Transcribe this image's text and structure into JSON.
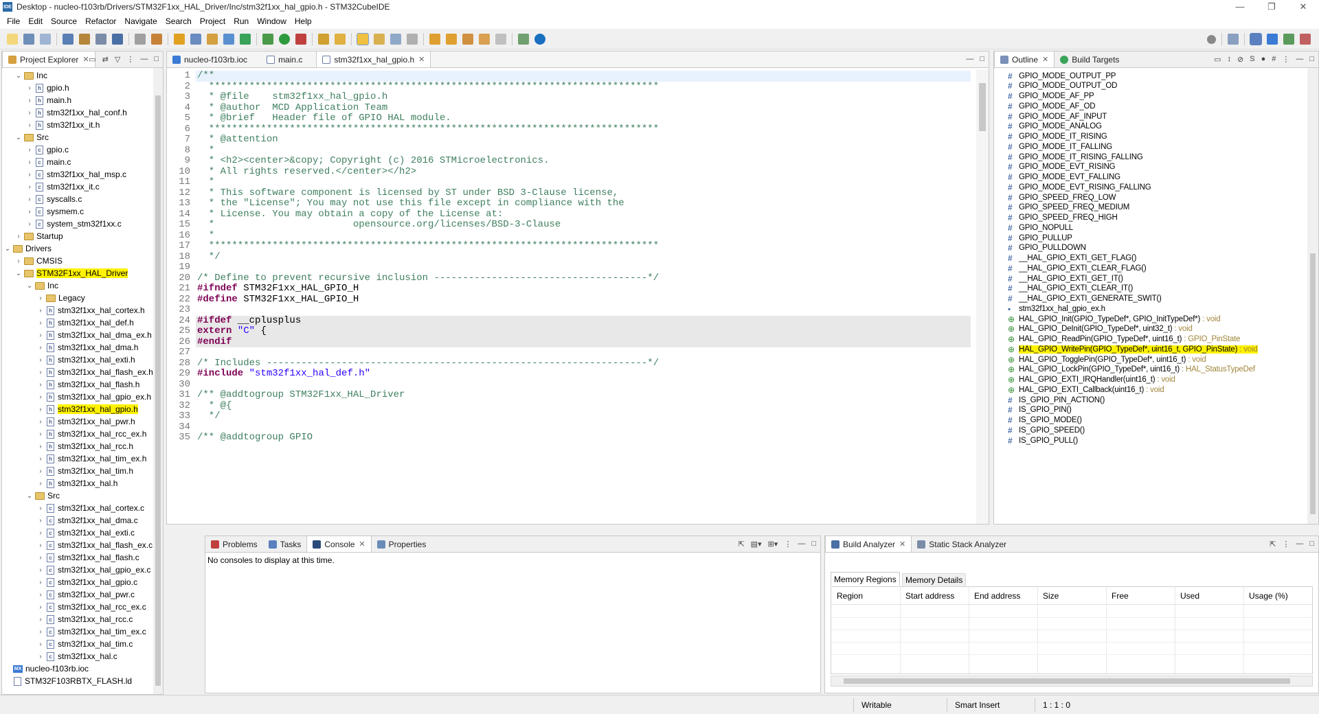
{
  "window": {
    "title": "Desktop - nucleo-f103rb/Drivers/STM32F1xx_HAL_Driver/Inc/stm32f1xx_hal_gpio.h - STM32CubeIDE",
    "app_icon": "IDE",
    "controls": [
      "—",
      "❐",
      "✕"
    ]
  },
  "menu": [
    "File",
    "Edit",
    "Source",
    "Refactor",
    "Navigate",
    "Search",
    "Project",
    "Run",
    "Window",
    "Help"
  ],
  "project_explorer": {
    "title": "Project Explorer",
    "items": [
      {
        "label": "Inc",
        "type": "folder",
        "level": 2,
        "arrow": "open"
      },
      {
        "label": "gpio.h",
        "type": "h",
        "level": 3,
        "arrow": "closed"
      },
      {
        "label": "main.h",
        "type": "h",
        "level": 3,
        "arrow": "closed"
      },
      {
        "label": "stm32f1xx_hal_conf.h",
        "type": "h",
        "level": 3,
        "arrow": "closed"
      },
      {
        "label": "stm32f1xx_it.h",
        "type": "h",
        "level": 3,
        "arrow": "closed"
      },
      {
        "label": "Src",
        "type": "folder",
        "level": 2,
        "arrow": "open"
      },
      {
        "label": "gpio.c",
        "type": "c",
        "level": 3,
        "arrow": "closed"
      },
      {
        "label": "main.c",
        "type": "c",
        "level": 3,
        "arrow": "closed"
      },
      {
        "label": "stm32f1xx_hal_msp.c",
        "type": "c",
        "level": 3,
        "arrow": "closed"
      },
      {
        "label": "stm32f1xx_it.c",
        "type": "c",
        "level": 3,
        "arrow": "closed"
      },
      {
        "label": "syscalls.c",
        "type": "c",
        "level": 3,
        "arrow": "closed"
      },
      {
        "label": "sysmem.c",
        "type": "c",
        "level": 3,
        "arrow": "closed"
      },
      {
        "label": "system_stm32f1xx.c",
        "type": "c",
        "level": 3,
        "arrow": "closed"
      },
      {
        "label": "Startup",
        "type": "folder",
        "level": 2,
        "arrow": "closed"
      },
      {
        "label": "Drivers",
        "type": "folder",
        "level": 1,
        "arrow": "open"
      },
      {
        "label": "CMSIS",
        "type": "folder",
        "level": 2,
        "arrow": "closed"
      },
      {
        "label": "STM32F1xx_HAL_Driver",
        "type": "folder",
        "level": 2,
        "arrow": "open",
        "highlight": true
      },
      {
        "label": "Inc",
        "type": "folder",
        "level": 3,
        "arrow": "open"
      },
      {
        "label": "Legacy",
        "type": "folder",
        "level": 4,
        "arrow": "closed"
      },
      {
        "label": "stm32f1xx_hal_cortex.h",
        "type": "h",
        "level": 4,
        "arrow": "closed"
      },
      {
        "label": "stm32f1xx_hal_def.h",
        "type": "h",
        "level": 4,
        "arrow": "closed"
      },
      {
        "label": "stm32f1xx_hal_dma_ex.h",
        "type": "h",
        "level": 4,
        "arrow": "closed"
      },
      {
        "label": "stm32f1xx_hal_dma.h",
        "type": "h",
        "level": 4,
        "arrow": "closed"
      },
      {
        "label": "stm32f1xx_hal_exti.h",
        "type": "h",
        "level": 4,
        "arrow": "closed"
      },
      {
        "label": "stm32f1xx_hal_flash_ex.h",
        "type": "h",
        "level": 4,
        "arrow": "closed"
      },
      {
        "label": "stm32f1xx_hal_flash.h",
        "type": "h",
        "level": 4,
        "arrow": "closed"
      },
      {
        "label": "stm32f1xx_hal_gpio_ex.h",
        "type": "h",
        "level": 4,
        "arrow": "closed"
      },
      {
        "label": "stm32f1xx_hal_gpio.h",
        "type": "h",
        "level": 4,
        "arrow": "closed",
        "highlight": true
      },
      {
        "label": "stm32f1xx_hal_pwr.h",
        "type": "h",
        "level": 4,
        "arrow": "closed"
      },
      {
        "label": "stm32f1xx_hal_rcc_ex.h",
        "type": "h",
        "level": 4,
        "arrow": "closed"
      },
      {
        "label": "stm32f1xx_hal_rcc.h",
        "type": "h",
        "level": 4,
        "arrow": "closed"
      },
      {
        "label": "stm32f1xx_hal_tim_ex.h",
        "type": "h",
        "level": 4,
        "arrow": "closed"
      },
      {
        "label": "stm32f1xx_hal_tim.h",
        "type": "h",
        "level": 4,
        "arrow": "closed"
      },
      {
        "label": "stm32f1xx_hal.h",
        "type": "h",
        "level": 4,
        "arrow": "closed"
      },
      {
        "label": "Src",
        "type": "folder",
        "level": 3,
        "arrow": "open"
      },
      {
        "label": "stm32f1xx_hal_cortex.c",
        "type": "c",
        "level": 4,
        "arrow": "closed"
      },
      {
        "label": "stm32f1xx_hal_dma.c",
        "type": "c",
        "level": 4,
        "arrow": "closed"
      },
      {
        "label": "stm32f1xx_hal_exti.c",
        "type": "c",
        "level": 4,
        "arrow": "closed"
      },
      {
        "label": "stm32f1xx_hal_flash_ex.c",
        "type": "c",
        "level": 4,
        "arrow": "closed"
      },
      {
        "label": "stm32f1xx_hal_flash.c",
        "type": "c",
        "level": 4,
        "arrow": "closed"
      },
      {
        "label": "stm32f1xx_hal_gpio_ex.c",
        "type": "c",
        "level": 4,
        "arrow": "closed"
      },
      {
        "label": "stm32f1xx_hal_gpio.c",
        "type": "c",
        "level": 4,
        "arrow": "closed"
      },
      {
        "label": "stm32f1xx_hal_pwr.c",
        "type": "c",
        "level": 4,
        "arrow": "closed"
      },
      {
        "label": "stm32f1xx_hal_rcc_ex.c",
        "type": "c",
        "level": 4,
        "arrow": "closed"
      },
      {
        "label": "stm32f1xx_hal_rcc.c",
        "type": "c",
        "level": 4,
        "arrow": "closed"
      },
      {
        "label": "stm32f1xx_hal_tim_ex.c",
        "type": "c",
        "level": 4,
        "arrow": "closed"
      },
      {
        "label": "stm32f1xx_hal_tim.c",
        "type": "c",
        "level": 4,
        "arrow": "closed"
      },
      {
        "label": "stm32f1xx_hal.c",
        "type": "c",
        "level": 4,
        "arrow": "closed"
      },
      {
        "label": "nucleo-f103rb.ioc",
        "type": "mx",
        "level": 1,
        "arrow": "none"
      },
      {
        "label": "STM32F103RBTX_FLASH.ld",
        "type": "ld",
        "level": 1,
        "arrow": "none"
      }
    ]
  },
  "editor": {
    "tabs": [
      {
        "label": "nucleo-f103rb.ioc",
        "active": false
      },
      {
        "label": "main.c",
        "active": false
      },
      {
        "label": "stm32f1xx_hal_gpio.h",
        "active": true
      }
    ],
    "lines": [
      {
        "n": "1",
        "segs": [
          [
            "cm",
            "/**"
          ]
        ]
      },
      {
        "n": "2",
        "segs": [
          [
            "cm",
            "  ******************************************************************************"
          ]
        ]
      },
      {
        "n": "3",
        "segs": [
          [
            "cm",
            "  * @file    stm32f1xx_hal_gpio.h"
          ]
        ]
      },
      {
        "n": "4",
        "segs": [
          [
            "cm",
            "  * @author  MCD Application Team"
          ]
        ]
      },
      {
        "n": "5",
        "segs": [
          [
            "cm",
            "  * @brief   Header file of GPIO HAL module."
          ]
        ]
      },
      {
        "n": "6",
        "segs": [
          [
            "cm",
            "  ******************************************************************************"
          ]
        ]
      },
      {
        "n": "7",
        "segs": [
          [
            "cm",
            "  * @attention"
          ]
        ]
      },
      {
        "n": "8",
        "segs": [
          [
            "cm",
            "  *"
          ]
        ]
      },
      {
        "n": "9",
        "segs": [
          [
            "cm",
            "  * <h2><center>&copy; Copyright (c) 2016 STMicroelectronics."
          ]
        ]
      },
      {
        "n": "10",
        "segs": [
          [
            "cm",
            "  * All rights reserved.</center></h2>"
          ]
        ]
      },
      {
        "n": "11",
        "segs": [
          [
            "cm",
            "  *"
          ]
        ]
      },
      {
        "n": "12",
        "segs": [
          [
            "cm",
            "  * This software component is licensed by ST under BSD 3-Clause license,"
          ]
        ]
      },
      {
        "n": "13",
        "segs": [
          [
            "cm",
            "  * the \"License\"; You may not use this file except in compliance with the"
          ]
        ]
      },
      {
        "n": "14",
        "segs": [
          [
            "cm",
            "  * License. You may obtain a copy of the License at:"
          ]
        ]
      },
      {
        "n": "15",
        "segs": [
          [
            "cm",
            "  *                        opensource.org/licenses/BSD-3-Clause"
          ]
        ]
      },
      {
        "n": "16",
        "segs": [
          [
            "cm",
            "  *"
          ]
        ]
      },
      {
        "n": "17",
        "segs": [
          [
            "cm",
            "  ******************************************************************************"
          ]
        ]
      },
      {
        "n": "18",
        "segs": [
          [
            "cm",
            "  */"
          ]
        ]
      },
      {
        "n": "19",
        "segs": [
          [
            "",
            ""
          ]
        ]
      },
      {
        "n": "20",
        "segs": [
          [
            "cm",
            "/* Define to prevent recursive inclusion -------------------------------------*/"
          ]
        ]
      },
      {
        "n": "21",
        "segs": [
          [
            "kw",
            "#ifndef"
          ],
          [
            "",
            " STM32F1xx_HAL_GPIO_H"
          ]
        ]
      },
      {
        "n": "22",
        "segs": [
          [
            "kw",
            "#define"
          ],
          [
            "",
            " STM32F1xx_HAL_GPIO_H"
          ]
        ]
      },
      {
        "n": "23",
        "segs": [
          [
            "",
            ""
          ]
        ]
      },
      {
        "n": "24",
        "segs": [
          [
            "kw",
            "#ifdef"
          ],
          [
            "",
            " __cplusplus"
          ]
        ],
        "grey": true
      },
      {
        "n": "25",
        "segs": [
          [
            "kw",
            "extern"
          ],
          [
            "",
            " "
          ],
          [
            "st",
            "\"C\""
          ],
          [
            "",
            " {"
          ]
        ],
        "grey": true
      },
      {
        "n": "26",
        "segs": [
          [
            "kw",
            "#endif"
          ]
        ],
        "grey": true
      },
      {
        "n": "27",
        "segs": [
          [
            "",
            ""
          ]
        ]
      },
      {
        "n": "28",
        "segs": [
          [
            "cm",
            "/* Includes ------------------------------------------------------------------*/"
          ]
        ]
      },
      {
        "n": "29",
        "segs": [
          [
            "kw",
            "#include"
          ],
          [
            "",
            " "
          ],
          [
            "st",
            "\"stm32f1xx_hal_def.h\""
          ]
        ]
      },
      {
        "n": "30",
        "segs": [
          [
            "",
            ""
          ]
        ]
      },
      {
        "n": "31",
        "segs": [
          [
            "cm",
            "/** @addtogroup STM32F1xx_HAL_Driver"
          ]
        ]
      },
      {
        "n": "32",
        "segs": [
          [
            "cm",
            "  * @{"
          ]
        ]
      },
      {
        "n": "33",
        "segs": [
          [
            "cm",
            "  */"
          ]
        ]
      },
      {
        "n": "34",
        "segs": [
          [
            "",
            ""
          ]
        ]
      },
      {
        "n": "35",
        "segs": [
          [
            "cm",
            "/** @addtogroup GPIO"
          ]
        ]
      }
    ]
  },
  "outline": {
    "tabs": [
      "Outline",
      "Build Targets"
    ],
    "items": [
      {
        "kind": "define",
        "label": "GPIO_MODE_OUTPUT_PP"
      },
      {
        "kind": "define",
        "label": "GPIO_MODE_OUTPUT_OD"
      },
      {
        "kind": "define",
        "label": "GPIO_MODE_AF_PP"
      },
      {
        "kind": "define",
        "label": "GPIO_MODE_AF_OD"
      },
      {
        "kind": "define",
        "label": "GPIO_MODE_AF_INPUT"
      },
      {
        "kind": "define",
        "label": "GPIO_MODE_ANALOG"
      },
      {
        "kind": "define",
        "label": "GPIO_MODE_IT_RISING"
      },
      {
        "kind": "define",
        "label": "GPIO_MODE_IT_FALLING"
      },
      {
        "kind": "define",
        "label": "GPIO_MODE_IT_RISING_FALLING"
      },
      {
        "kind": "define",
        "label": "GPIO_MODE_EVT_RISING"
      },
      {
        "kind": "define",
        "label": "GPIO_MODE_EVT_FALLING"
      },
      {
        "kind": "define",
        "label": "GPIO_MODE_EVT_RISING_FALLING"
      },
      {
        "kind": "define",
        "label": "GPIO_SPEED_FREQ_LOW"
      },
      {
        "kind": "define",
        "label": "GPIO_SPEED_FREQ_MEDIUM"
      },
      {
        "kind": "define",
        "label": "GPIO_SPEED_FREQ_HIGH"
      },
      {
        "kind": "define",
        "label": "GPIO_NOPULL"
      },
      {
        "kind": "define",
        "label": "GPIO_PULLUP"
      },
      {
        "kind": "define",
        "label": "GPIO_PULLDOWN"
      },
      {
        "kind": "define",
        "label": "__HAL_GPIO_EXTI_GET_FLAG()"
      },
      {
        "kind": "define",
        "label": "__HAL_GPIO_EXTI_CLEAR_FLAG()"
      },
      {
        "kind": "define",
        "label": "__HAL_GPIO_EXTI_GET_IT()"
      },
      {
        "kind": "define",
        "label": "__HAL_GPIO_EXTI_CLEAR_IT()"
      },
      {
        "kind": "define",
        "label": "__HAL_GPIO_EXTI_GENERATE_SWIT()"
      },
      {
        "kind": "include",
        "label": "stm32f1xx_hal_gpio_ex.h"
      },
      {
        "kind": "func",
        "label": "HAL_GPIO_Init(GPIO_TypeDef*, GPIO_InitTypeDef*)",
        "type": " : void"
      },
      {
        "kind": "func",
        "label": "HAL_GPIO_DeInit(GPIO_TypeDef*, uint32_t)",
        "type": " : void"
      },
      {
        "kind": "func",
        "label": "HAL_GPIO_ReadPin(GPIO_TypeDef*, uint16_t)",
        "type": " : GPIO_PinState"
      },
      {
        "kind": "func",
        "label": "HAL_GPIO_WritePin(GPIO_TypeDef*, uint16_t, GPIO_PinState)",
        "type": " : void",
        "highlight": true
      },
      {
        "kind": "func",
        "label": "HAL_GPIO_TogglePin(GPIO_TypeDef*, uint16_t)",
        "type": " : void"
      },
      {
        "kind": "func",
        "label": "HAL_GPIO_LockPin(GPIO_TypeDef*, uint16_t)",
        "type": " : HAL_StatusTypeDef"
      },
      {
        "kind": "func",
        "label": "HAL_GPIO_EXTI_IRQHandler(uint16_t)",
        "type": " : void"
      },
      {
        "kind": "func",
        "label": "HAL_GPIO_EXTI_Callback(uint16_t)",
        "type": " : void"
      },
      {
        "kind": "define",
        "label": "IS_GPIO_PIN_ACTION()"
      },
      {
        "kind": "define",
        "label": "IS_GPIO_PIN()"
      },
      {
        "kind": "define",
        "label": "IS_GPIO_MODE()"
      },
      {
        "kind": "define",
        "label": "IS_GPIO_SPEED()"
      },
      {
        "kind": "define",
        "label": "IS_GPIO_PULL()"
      }
    ]
  },
  "console": {
    "tabs": [
      "Problems",
      "Tasks",
      "Console",
      "Properties"
    ],
    "message": "No consoles to display at this time."
  },
  "build_analyzer": {
    "tabs": [
      "Build Analyzer",
      "Static Stack Analyzer"
    ],
    "subtabs": [
      "Memory Regions",
      "Memory Details"
    ],
    "columns": [
      "Region",
      "Start address",
      "End address",
      "Size",
      "Free",
      "Used",
      "Usage (%)"
    ]
  },
  "status": {
    "writable": "Writable",
    "insert": "Smart Insert",
    "position": "1 : 1 : 0"
  },
  "colors": {
    "highlight": "#fff200",
    "comment": "#3f7f5f",
    "keyword": "#7f0055",
    "string": "#2a00ff"
  }
}
